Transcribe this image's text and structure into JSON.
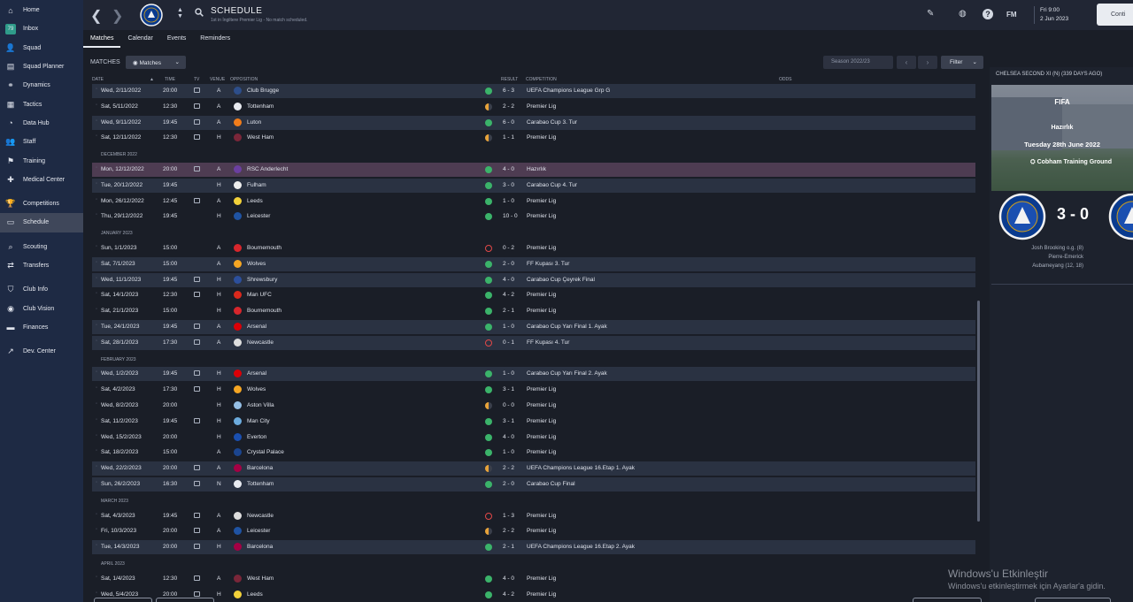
{
  "sidebar": {
    "items": [
      {
        "label": "Home",
        "icon": "home-icon",
        "glyph": "⌂"
      },
      {
        "label": "Inbox",
        "icon": "inbox-icon",
        "glyph": "✉",
        "badge": "79"
      },
      {
        "label": "Squad",
        "icon": "squad-icon",
        "glyph": "👤"
      },
      {
        "label": "Squad Planner",
        "icon": "squad-planner-icon",
        "glyph": "▤"
      },
      {
        "label": "Dynamics",
        "icon": "dynamics-icon",
        "glyph": "⚭"
      },
      {
        "label": "Tactics",
        "icon": "tactics-icon",
        "glyph": "▦"
      },
      {
        "label": "Data Hub",
        "icon": "data-hub-icon",
        "glyph": "◔"
      },
      {
        "label": "Staff",
        "icon": "staff-icon",
        "glyph": "👥"
      },
      {
        "label": "Training",
        "icon": "training-icon",
        "glyph": "⚑"
      },
      {
        "label": "Medical Center",
        "icon": "medical-icon",
        "glyph": "✚"
      },
      {
        "label": "Competitions",
        "icon": "competitions-icon",
        "glyph": "🏆"
      },
      {
        "label": "Schedule",
        "icon": "schedule-icon",
        "glyph": "▭"
      },
      {
        "label": "Scouting",
        "icon": "scouting-icon",
        "glyph": "⌕"
      },
      {
        "label": "Transfers",
        "icon": "transfers-icon",
        "glyph": "⇄"
      },
      {
        "label": "Club Info",
        "icon": "club-info-icon",
        "glyph": "⛉"
      },
      {
        "label": "Club Vision",
        "icon": "club-vision-icon",
        "glyph": "◉"
      },
      {
        "label": "Finances",
        "icon": "finances-icon",
        "glyph": "▬"
      },
      {
        "label": "Dev. Center",
        "icon": "dev-center-icon",
        "glyph": "↗"
      }
    ]
  },
  "header": {
    "title": "SCHEDULE",
    "subtitle": "1st in İngiltere Premier Lig - No match scheduled.",
    "date_line1": "Fri 9:00",
    "date_line2": "2 Jun 2023",
    "fm_label": "FM",
    "continue_label": "Conti"
  },
  "tabs": [
    "Matches",
    "Calendar",
    "Events",
    "Reminders"
  ],
  "toolbar": {
    "section_label": "MATCHES",
    "view_dropdown": "Matches",
    "season": "Season 2022/23",
    "filter_label": "Filter"
  },
  "table": {
    "columns": {
      "date": "DATE",
      "time": "TIME",
      "tv": "TV",
      "venue": "VENUE",
      "opposition": "OPPOSITION",
      "result": "RESULT",
      "competition": "COMPETITION",
      "odds": "ODDS"
    },
    "rows": [
      {
        "date": "Wed, 2/11/2022",
        "time": "20:00",
        "tv": true,
        "venue": "A",
        "opp": "Club Brugge",
        "logo": "#2d4e8a",
        "outcome": "win",
        "result": "6 - 3",
        "comp": "UEFA Champions League Grp G",
        "style": "alt"
      },
      {
        "date": "Sat, 5/11/2022",
        "time": "12:30",
        "tv": true,
        "venue": "A",
        "opp": "Tottenham",
        "logo": "#e8eaf0",
        "outcome": "draw",
        "result": "2 - 2",
        "comp": "Premier Lig",
        "style": ""
      },
      {
        "date": "Wed, 9/11/2022",
        "time": "19:45",
        "tv": true,
        "venue": "A",
        "opp": "Luton",
        "logo": "#f07c1a",
        "outcome": "win",
        "result": "6 - 0",
        "comp": "Carabao Cup 3. Tur",
        "style": "alt"
      },
      {
        "date": "Sat, 12/11/2022",
        "time": "12:30",
        "tv": true,
        "venue": "H",
        "opp": "West Ham",
        "logo": "#7a2639",
        "outcome": "draw",
        "result": "1 - 1",
        "comp": "Premier Lig",
        "style": ""
      },
      {
        "header": "DECEMBER 2022"
      },
      {
        "date": "Mon, 12/12/2022",
        "time": "20:00",
        "tv": true,
        "venue": "A",
        "opp": "RSC Anderlecht",
        "logo": "#6b3fa0",
        "outcome": "win",
        "result": "4 - 0",
        "comp": "Hazırlık",
        "style": "purple"
      },
      {
        "date": "Tue, 20/12/2022",
        "time": "19:45",
        "tv": false,
        "venue": "H",
        "opp": "Fulham",
        "logo": "#eeeeee",
        "outcome": "win",
        "result": "3 - 0",
        "comp": "Carabao Cup 4. Tur",
        "style": "alt"
      },
      {
        "date": "Mon, 26/12/2022",
        "time": "12:45",
        "tv": true,
        "venue": "A",
        "opp": "Leeds",
        "logo": "#f2d13a",
        "outcome": "win",
        "result": "1 - 0",
        "comp": "Premier Lig",
        "style": ""
      },
      {
        "date": "Thu, 29/12/2022",
        "time": "19:45",
        "tv": false,
        "venue": "H",
        "opp": "Leicester",
        "logo": "#1f53a3",
        "outcome": "win",
        "result": "10 - 0",
        "comp": "Premier Lig",
        "style": ""
      },
      {
        "header": "JANUARY 2023"
      },
      {
        "date": "Sun, 1/1/2023",
        "time": "15:00",
        "tv": false,
        "venue": "A",
        "opp": "Bournemouth",
        "logo": "#d7262c",
        "outcome": "loss",
        "result": "0 - 2",
        "comp": "Premier Lig",
        "style": ""
      },
      {
        "date": "Sat, 7/1/2023",
        "time": "15:00",
        "tv": false,
        "venue": "A",
        "opp": "Wolves",
        "logo": "#f5a623",
        "outcome": "win",
        "result": "2 - 0",
        "comp": "FF Kupası 3. Tur",
        "style": "alt"
      },
      {
        "date": "Wed, 11/1/2023",
        "time": "19:45",
        "tv": true,
        "venue": "H",
        "opp": "Shrewsbury",
        "logo": "#2c4f9c",
        "outcome": "win",
        "result": "4 - 0",
        "comp": "Carabao Cup Çeyrek Final",
        "style": "alt"
      },
      {
        "date": "Sat, 14/1/2023",
        "time": "12:30",
        "tv": true,
        "venue": "H",
        "opp": "Man UFC",
        "logo": "#da291c",
        "outcome": "win",
        "result": "4 - 2",
        "comp": "Premier Lig",
        "style": ""
      },
      {
        "date": "Sat, 21/1/2023",
        "time": "15:00",
        "tv": false,
        "venue": "H",
        "opp": "Bournemouth",
        "logo": "#d7262c",
        "outcome": "win",
        "result": "2 - 1",
        "comp": "Premier Lig",
        "style": ""
      },
      {
        "date": "Tue, 24/1/2023",
        "time": "19:45",
        "tv": true,
        "venue": "A",
        "opp": "Arsenal",
        "logo": "#db0007",
        "outcome": "win",
        "result": "1 - 0",
        "comp": "Carabao Cup Yarı Final 1. Ayak",
        "style": "alt"
      },
      {
        "date": "Sat, 28/1/2023",
        "time": "17:30",
        "tv": true,
        "venue": "A",
        "opp": "Newcastle",
        "logo": "#dddddd",
        "outcome": "loss",
        "result": "0 - 1",
        "comp": "FF Kupası 4. Tur",
        "style": "alt"
      },
      {
        "header": "FEBRUARY 2023"
      },
      {
        "date": "Wed, 1/2/2023",
        "time": "19:45",
        "tv": true,
        "venue": "H",
        "opp": "Arsenal",
        "logo": "#db0007",
        "outcome": "win",
        "result": "1 - 0",
        "comp": "Carabao Cup Yarı Final 2. Ayak",
        "style": "alt"
      },
      {
        "date": "Sat, 4/2/2023",
        "time": "17:30",
        "tv": true,
        "venue": "H",
        "opp": "Wolves",
        "logo": "#f5a623",
        "outcome": "win",
        "result": "3 - 1",
        "comp": "Premier Lig",
        "style": ""
      },
      {
        "date": "Wed, 8/2/2023",
        "time": "20:00",
        "tv": false,
        "venue": "H",
        "opp": "Aston Villa",
        "logo": "#95bfe5",
        "outcome": "draw",
        "result": "0 - 0",
        "comp": "Premier Lig",
        "style": ""
      },
      {
        "date": "Sat, 11/2/2023",
        "time": "19:45",
        "tv": true,
        "venue": "H",
        "opp": "Man City",
        "logo": "#6cabdd",
        "outcome": "win",
        "result": "3 - 1",
        "comp": "Premier Lig",
        "style": ""
      },
      {
        "date": "Wed, 15/2/2023",
        "time": "20:00",
        "tv": false,
        "venue": "H",
        "opp": "Everton",
        "logo": "#1a4fb0",
        "outcome": "win",
        "result": "4 - 0",
        "comp": "Premier Lig",
        "style": ""
      },
      {
        "date": "Sat, 18/2/2023",
        "time": "15:00",
        "tv": false,
        "venue": "A",
        "opp": "Crystal Palace",
        "logo": "#1b458f",
        "outcome": "win",
        "result": "1 - 0",
        "comp": "Premier Lig",
        "style": ""
      },
      {
        "date": "Wed, 22/2/2023",
        "time": "20:00",
        "tv": true,
        "venue": "A",
        "opp": "Barcelona",
        "logo": "#a50044",
        "outcome": "draw",
        "result": "2 - 2",
        "comp": "UEFA Champions League 16.Etap 1. Ayak",
        "style": "alt"
      },
      {
        "date": "Sun, 26/2/2023",
        "time": "16:30",
        "tv": true,
        "venue": "N",
        "opp": "Tottenham",
        "logo": "#e8eaf0",
        "outcome": "win",
        "result": "2 - 0",
        "comp": "Carabao Cup Final",
        "style": "alt"
      },
      {
        "header": "MARCH 2023"
      },
      {
        "date": "Sat, 4/3/2023",
        "time": "19:45",
        "tv": true,
        "venue": "A",
        "opp": "Newcastle",
        "logo": "#dddddd",
        "outcome": "loss",
        "result": "1 - 3",
        "comp": "Premier Lig",
        "style": ""
      },
      {
        "date": "Fri, 10/3/2023",
        "time": "20:00",
        "tv": true,
        "venue": "A",
        "opp": "Leicester",
        "logo": "#1f53a3",
        "outcome": "draw",
        "result": "2 - 2",
        "comp": "Premier Lig",
        "style": ""
      },
      {
        "date": "Tue, 14/3/2023",
        "time": "20:00",
        "tv": true,
        "venue": "H",
        "opp": "Barcelona",
        "logo": "#a50044",
        "outcome": "win",
        "result": "2 - 1",
        "comp": "UEFA Champions League 16.Etap 2. Ayak",
        "style": "alt"
      },
      {
        "header": "APRIL 2023"
      },
      {
        "date": "Sat, 1/4/2023",
        "time": "12:30",
        "tv": true,
        "venue": "A",
        "opp": "West Ham",
        "logo": "#7a2639",
        "outcome": "win",
        "result": "4 - 0",
        "comp": "Premier Lig",
        "style": ""
      },
      {
        "date": "Wed, 5/4/2023",
        "time": "20:00",
        "tv": true,
        "venue": "H",
        "opp": "Leeds",
        "logo": "#f2d13a",
        "outcome": "win",
        "result": "4 - 2",
        "comp": "Premier Lig",
        "style": ""
      }
    ]
  },
  "outcome_colors": {
    "win": "#3bb36a",
    "draw": "#e8a33a",
    "loss": "#e24848"
  },
  "right_panel": {
    "title": "CHELSEA SECOND XI (N) (339 DAYS AGO)",
    "brand": "FIFA",
    "match_type": "Hazırlık",
    "match_date": "Tuesday 28th June 2022",
    "venue": "Cobham Training Ground",
    "score": "3 - 0",
    "scorer1": "Josh Brooking o.g. (8)",
    "scorer2": "Pierre-Emerick",
    "scorer3": "Aubameyang (12, 18)"
  },
  "watermark": {
    "line1": "Windows'u Etkinleştir",
    "line2": "Windows'u etkinleştirmek için Ayarlar'a gidin."
  }
}
